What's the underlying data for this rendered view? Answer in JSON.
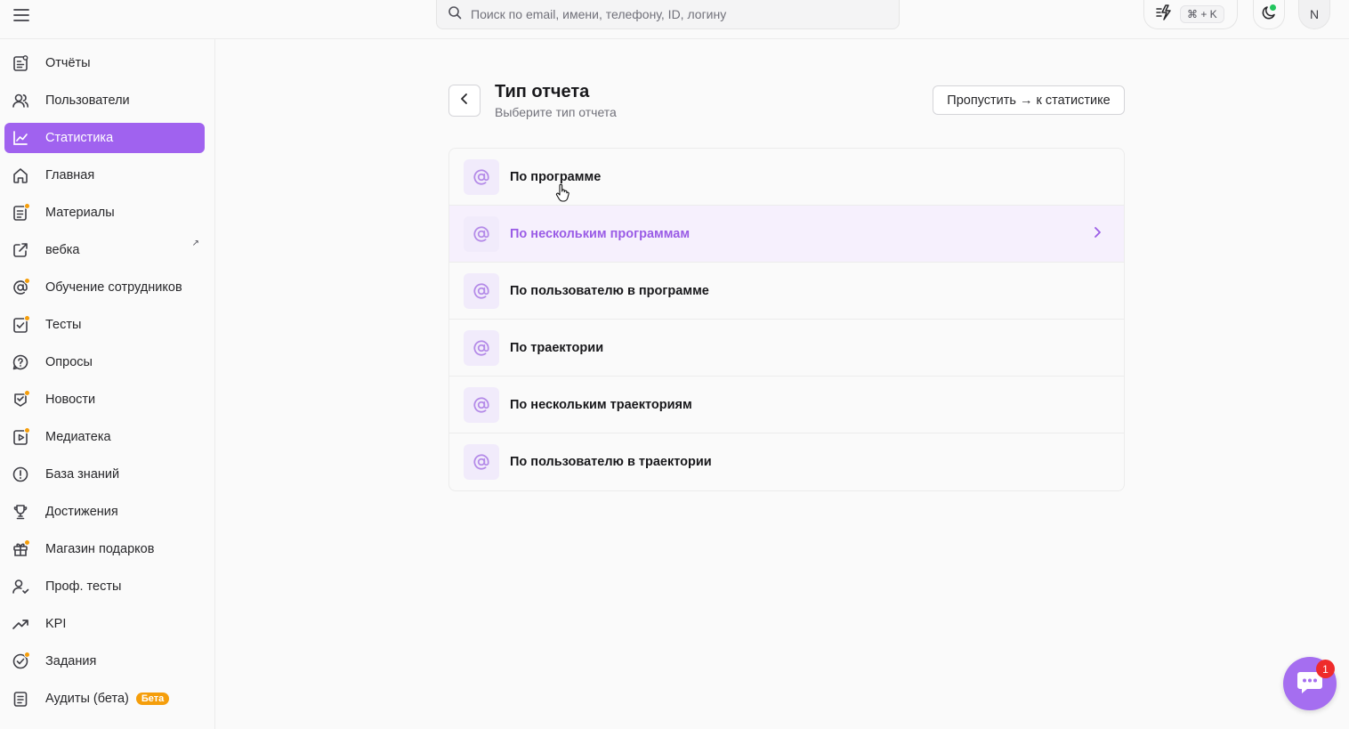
{
  "search": {
    "placeholder": "Поиск по email, имени, телефону, ID, логину"
  },
  "topbar": {
    "shortcut": "⌘ + K",
    "avatar_initial": "N"
  },
  "sidebar": {
    "items": [
      {
        "label": "Отчёты",
        "icon": "report-icon",
        "dot": false
      },
      {
        "label": "Пользователи",
        "icon": "users-icon",
        "dot": false
      },
      {
        "label": "Статистика",
        "icon": "chart-line-icon",
        "dot": false,
        "active": true
      },
      {
        "label": "Главная",
        "icon": "home-icon",
        "dot": false
      },
      {
        "label": "Материалы",
        "icon": "document-icon",
        "dot": true
      },
      {
        "label": "вебка",
        "icon": "external-link-icon",
        "dot": false,
        "external": "↗"
      },
      {
        "label": "Обучение сотрудников",
        "icon": "at-sign-icon",
        "dot": true
      },
      {
        "label": "Тесты",
        "icon": "checklist-icon",
        "dot": true
      },
      {
        "label": "Опросы",
        "icon": "question-bubble-icon",
        "dot": false
      },
      {
        "label": "Новости",
        "icon": "news-icon",
        "dot": true
      },
      {
        "label": "Медиатека",
        "icon": "play-icon",
        "dot": true
      },
      {
        "label": "База знаний",
        "icon": "info-circle-icon",
        "dot": false
      },
      {
        "label": "Достижения",
        "icon": "trophy-icon",
        "dot": false
      },
      {
        "label": "Магазин подарков",
        "icon": "gift-icon",
        "dot": true
      },
      {
        "label": "Проф. тесты",
        "icon": "user-check-icon",
        "dot": false
      },
      {
        "label": "KPI",
        "icon": "trend-up-icon",
        "dot": false
      },
      {
        "label": "Задания",
        "icon": "check-circle-icon",
        "dot": true
      },
      {
        "label": "Аудиты (бета)",
        "icon": "clipboard-icon",
        "dot": false,
        "badge": "Бета"
      }
    ]
  },
  "main": {
    "title": "Тип отчета",
    "subtitle": "Выберите тип отчета",
    "skip_label": "Пропустить → к статистике",
    "report_types": [
      {
        "label": "По программе"
      },
      {
        "label": "По нескольким программам",
        "hovered": true
      },
      {
        "label": "По пользователю в программе"
      },
      {
        "label": "По траектории"
      },
      {
        "label": "По нескольким траекториям"
      },
      {
        "label": "По пользователю в траектории"
      }
    ]
  },
  "chat": {
    "badge_count": "1"
  },
  "colors": {
    "accent": "#a062ef",
    "accent_light": "#f1ebfb",
    "badge_orange": "#f59e0b",
    "notify_red": "#ef2b2b",
    "online_green": "#22c55e"
  }
}
